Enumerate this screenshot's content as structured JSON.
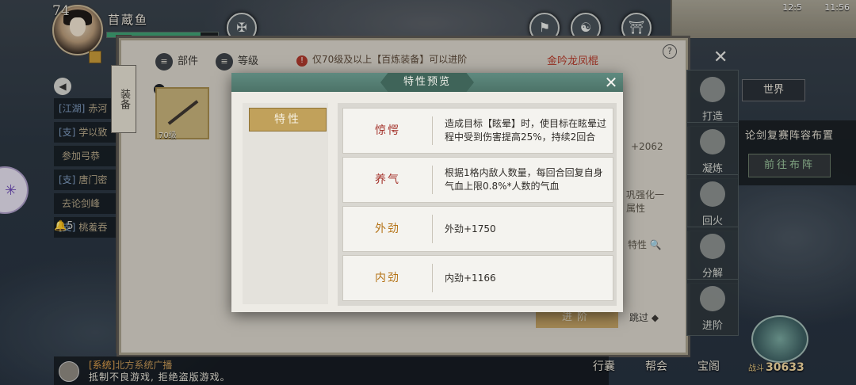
{
  "hud": {
    "level": "74",
    "player_name": "苜蔵鱼",
    "hp_fraction": 0.84,
    "minimap_time": "12:5",
    "minimap_clock": "11:56",
    "world_label": "世界"
  },
  "left_list": [
    {
      "tag": "[江湖]",
      "text": "赤河"
    },
    {
      "tag": "[支]",
      "text": "学以致"
    },
    {
      "tag": "",
      "text": "参加弓恭"
    },
    {
      "tag": "[支]",
      "text": "唐门密"
    },
    {
      "tag": "",
      "text": "去论剑峰"
    },
    {
      "tag": "[支]",
      "text": "桃羞吞"
    }
  ],
  "bell_count": "5",
  "system": {
    "label": "[系统]",
    "line1": "北方系统广播",
    "line2": "抵制不良游戏, 拒绝盗版游戏。"
  },
  "bottom_nav": [
    "行囊",
    "帮会",
    "宝阁"
  ],
  "power": {
    "prefix": "战斗",
    "value": "30633"
  },
  "right_panel": {
    "text": "论剑复赛阵容布置",
    "button": "前往布阵"
  },
  "equip": {
    "scroll_label": "装备",
    "tab_parts": "部件",
    "tab_level": "等级",
    "notice": "仅70级及以上【百炼装备】可以进阶",
    "item_name": "金吟龙凤棍",
    "item_level": "70级",
    "plus": "+2062",
    "strengthen": "巩强化一",
    "strengthen2": "属性",
    "trait_link": "特性",
    "advance_button": "进阶",
    "skip_label": "跳过",
    "side_tabs": [
      "打造",
      "凝炼",
      "回火",
      "分解",
      "进阶"
    ]
  },
  "modal": {
    "title": "特性预览",
    "tab": "特性",
    "traits": [
      {
        "name": "惊愕",
        "color": "#a3312a",
        "desc": "造成目标【眩晕】时，使目标在眩晕过程中受到伤害提高25%，持续2回合"
      },
      {
        "name": "养气",
        "color": "#a3312a",
        "desc": "根据1格内敌人数量，每回合回复自身气血上限0.8%*人数的气血"
      },
      {
        "name": "外劲",
        "color": "#b57418",
        "desc": "外劲+1750"
      },
      {
        "name": "内劲",
        "color": "#b57418",
        "desc": "内劲+1166"
      }
    ]
  }
}
